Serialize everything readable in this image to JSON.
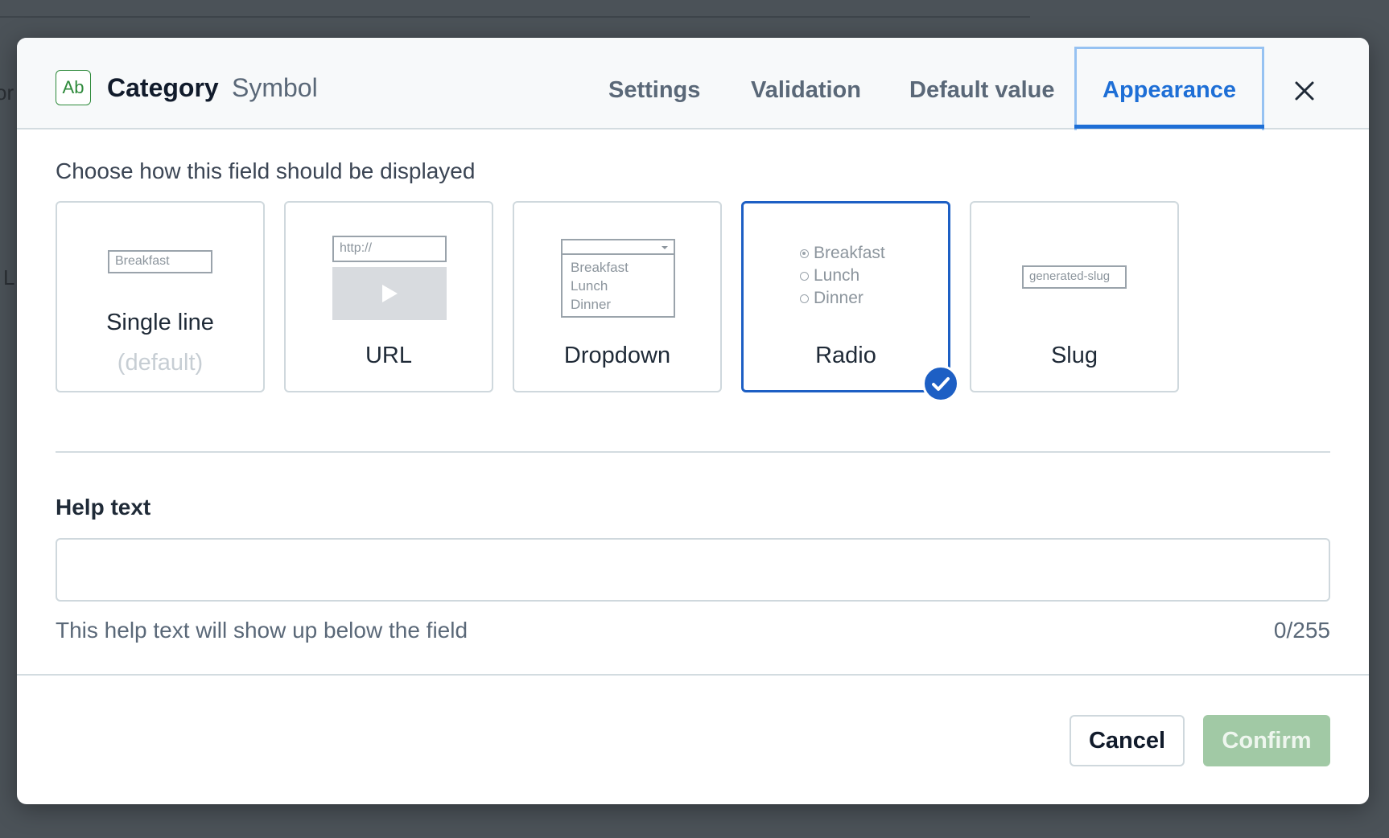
{
  "header": {
    "type_badge": "Ab",
    "title": "Category",
    "subtitle": "Symbol",
    "tabs": [
      {
        "label": "Settings",
        "active": false
      },
      {
        "label": "Validation",
        "active": false
      },
      {
        "label": "Default value",
        "active": false
      },
      {
        "label": "Appearance",
        "active": true
      }
    ],
    "close_icon": "close-icon"
  },
  "background": {
    "partial_text_1": "or",
    "partial_text_2": "L"
  },
  "appearance": {
    "section_title": "Choose how this field should be displayed",
    "options": [
      {
        "label": "Single line",
        "sublabel": "(default)",
        "preview_text": "Breakfast",
        "selected": false
      },
      {
        "label": "URL",
        "preview_text": "http://",
        "selected": false
      },
      {
        "label": "Dropdown",
        "preview_items": [
          "Breakfast",
          "Lunch",
          "Dinner"
        ],
        "selected": false
      },
      {
        "label": "Radio",
        "preview_items": [
          "Breakfast",
          "Lunch",
          "Dinner"
        ],
        "selected": true
      },
      {
        "label": "Slug",
        "preview_text": "generated-slug",
        "selected": false
      }
    ],
    "selected_icon": "check-circle-icon"
  },
  "help_text": {
    "label": "Help text",
    "value": "",
    "placeholder": "",
    "hint": "This help text will show up below the field",
    "counter": "0/255"
  },
  "footer": {
    "cancel_label": "Cancel",
    "confirm_label": "Confirm"
  },
  "colors": {
    "accent": "#1e6fd6",
    "selected_border": "#1d5fc4",
    "confirm_disabled": "#a1c9a5",
    "badge_green": "#2e8a3b"
  }
}
